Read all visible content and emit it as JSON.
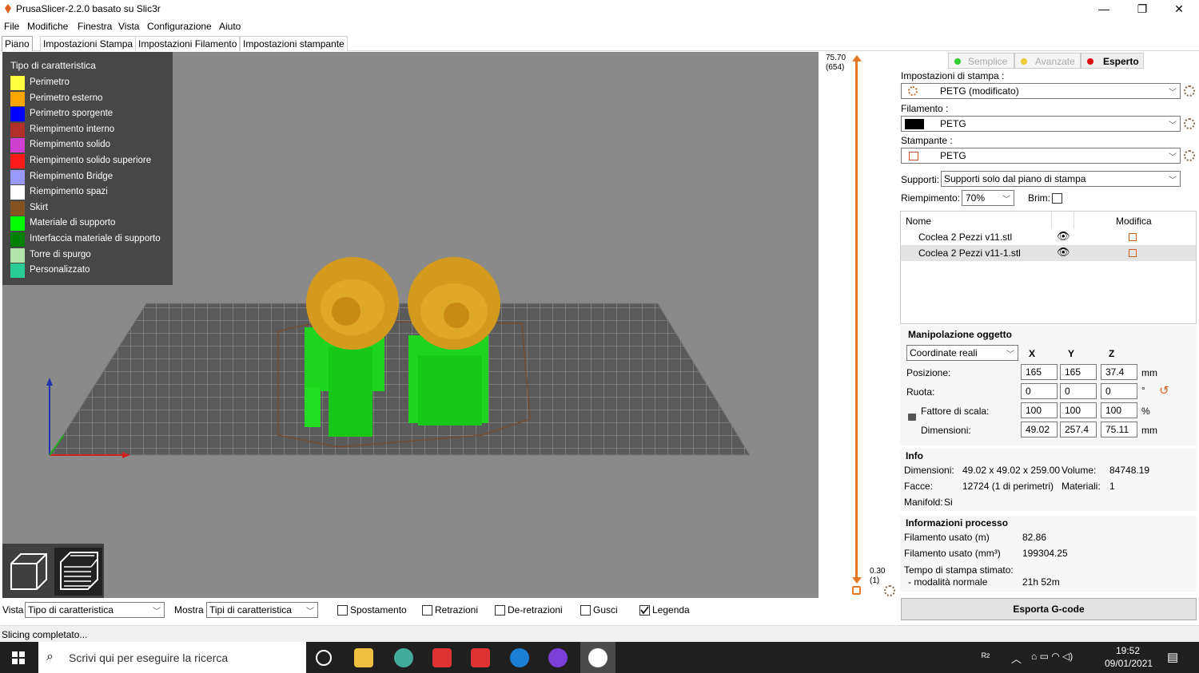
{
  "window": {
    "title": "PrusaSlicer-2.2.0 basato su Slic3r",
    "minimize": "—",
    "maximize": "❐",
    "close": "✕"
  },
  "menu": [
    "File",
    "Modifiche",
    "Finestra",
    "Vista",
    "Configurazione",
    "Aiuto"
  ],
  "tabs": [
    "Piano",
    "Impostazioni Stampa",
    "Impostazioni Filamento",
    "Impostazioni stampante"
  ],
  "legend": {
    "title": "Tipo di caratteristica",
    "items": [
      {
        "label": "Perimetro",
        "color": "#ffff40"
      },
      {
        "label": "Perimetro esterno",
        "color": "#ffa500"
      },
      {
        "label": "Perimetro sporgente",
        "color": "#0000ff"
      },
      {
        "label": "Riempimento interno",
        "color": "#b03029"
      },
      {
        "label": "Riempimento solido",
        "color": "#d040d0"
      },
      {
        "label": "Riempimento solido superiore",
        "color": "#ff1a1a"
      },
      {
        "label": "Riempimento Bridge",
        "color": "#9999ff"
      },
      {
        "label": "Riempimento spazi",
        "color": "#ffffff"
      },
      {
        "label": "Skirt",
        "color": "#845321"
      },
      {
        "label": "Materiale di supporto",
        "color": "#00ff00"
      },
      {
        "label": "Interfaccia materiale di supporto",
        "color": "#008000"
      },
      {
        "label": "Torre di spurgo",
        "color": "#b3e3ab"
      },
      {
        "label": "Personalizzato",
        "color": "#28cc94"
      }
    ]
  },
  "slider": {
    "top_value": "75.70",
    "top_layer": "(654)",
    "bottom_value": "0.30",
    "bottom_layer": "(1)"
  },
  "mode": {
    "simple": "Semplice",
    "advanced": "Avanzate",
    "expert": "Esperto"
  },
  "presets": {
    "print_label": "Impostazioni di stampa :",
    "print_value": "PETG (modificato)",
    "filament_label": "Filamento :",
    "filament_value": "PETG",
    "printer_label": "Stampante :",
    "printer_value": "PETG",
    "supports_label": "Supporti:",
    "supports_value": "Supporti solo dal piano di stampa",
    "infill_label": "Riempimento:",
    "infill_value": "70%",
    "brim_label": "Brim:"
  },
  "objects": {
    "col_name": "Nome",
    "col_edit": "Modifica",
    "rows": [
      {
        "name": "Coclea 2 Pezzi v11.stl"
      },
      {
        "name": "Coclea 2 Pezzi v11-1.stl"
      }
    ]
  },
  "manipulation": {
    "title": "Manipolazione oggetto",
    "coords": "Coordinate reali",
    "x": "X",
    "y": "Y",
    "z": "Z",
    "position_label": "Posizione:",
    "position": [
      "165",
      "165",
      "37.4"
    ],
    "position_unit": "mm",
    "rotate_label": "Ruota:",
    "rotate": [
      "0",
      "0",
      "0"
    ],
    "rotate_unit": "°",
    "scale_label": "Fattore di scala:",
    "scale": [
      "100",
      "100",
      "100"
    ],
    "scale_unit": "%",
    "size_label": "Dimensioni:",
    "size": [
      "49.02",
      "257.4",
      "75.11"
    ],
    "size_unit": "mm"
  },
  "info": {
    "title": "Info",
    "dims_label": "Dimensioni:",
    "dims_value": "49.02 x 49.02 x 259.00",
    "volume_label": "Volume:",
    "volume_value": "84748.19",
    "facets_label": "Facce:",
    "facets_value": "12724 (1 di perimetri)",
    "materials_label": "Materiali:",
    "materials_value": "1",
    "manifold_label": "Manifold:",
    "manifold_value": "Si"
  },
  "process": {
    "title": "Informazioni processo",
    "fil_m_label": "Filamento usato (m)",
    "fil_m_value": "82.86",
    "fil_mm3_label": "Filamento usato (mm³)",
    "fil_mm3_value": "199304.25",
    "time_label": "Tempo di stampa stimato:",
    "mode_label": "- modalità normale",
    "mode_value": "21h 52m"
  },
  "export_button": "Esporta G-code",
  "bottom": {
    "view_label": "Vista",
    "view_value": "Tipo di caratteristica",
    "show_label": "Mostra",
    "show_value": "Tipi di caratteristica",
    "checks": [
      {
        "label": "Spostamento",
        "checked": false
      },
      {
        "label": "Retrazioni",
        "checked": false
      },
      {
        "label": "De-retrazioni",
        "checked": false
      },
      {
        "label": "Gusci",
        "checked": false
      },
      {
        "label": "Legenda",
        "checked": true
      }
    ]
  },
  "status": "Slicing completato...",
  "taskbar": {
    "search_placeholder": "Scrivi qui per eseguire la ricerca",
    "time": "19:52",
    "date": "09/01/2021"
  }
}
